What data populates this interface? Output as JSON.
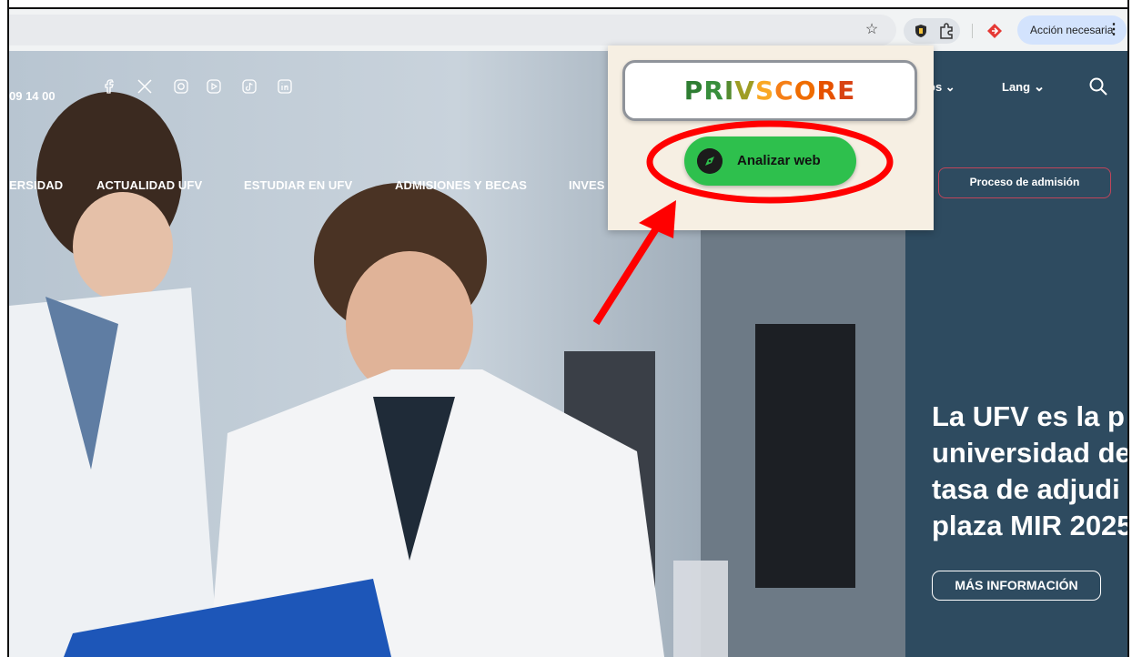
{
  "browser": {
    "bookmark_icon": "star-icon",
    "extension_icon": "privscore-shield-icon",
    "extensions_icon": "puzzle-icon",
    "action_label": "Acción necesaria",
    "menu_glyph": "⋮"
  },
  "site": {
    "phone_partial": "09 14 00",
    "social_icons": [
      "facebook-icon",
      "x-icon",
      "instagram-icon",
      "youtube-icon",
      "tiktok-icon",
      "linkedin-icon"
    ],
    "top_menu": {
      "item_partial": "os",
      "lang": "Lang"
    },
    "nav": [
      "ERSIDAD",
      "ACTUALIDAD UFV",
      "ESTUDIAR EN UFV",
      "ADMISIONES Y BECAS",
      "INVES"
    ],
    "admission_button": "Proceso de admisión",
    "headline_lines": [
      "La UFV es la p",
      "universidad de",
      "tasa de adjudi",
      "plaza MIR 2025"
    ],
    "more_button": "MÁS INFORMACIÓN",
    "panel_color": "#2e4b60"
  },
  "popup": {
    "logo_letters": [
      {
        "ch": "P",
        "color": "#2e7d32"
      },
      {
        "ch": "R",
        "color": "#388e3c"
      },
      {
        "ch": "I",
        "color": "#558b2f"
      },
      {
        "ch": "V",
        "color": "#9e9d24"
      },
      {
        "ch": "S",
        "color": "#f9a825"
      },
      {
        "ch": "C",
        "color": "#f57f17"
      },
      {
        "ch": "O",
        "color": "#ef6c00"
      },
      {
        "ch": "R",
        "color": "#e65100"
      },
      {
        "ch": "E",
        "color": "#d84315"
      }
    ],
    "analyze_label": "Analizar web",
    "analyze_icon": "compass-icon",
    "button_color": "#2ec04d"
  },
  "annotation_color": "#ff0000"
}
